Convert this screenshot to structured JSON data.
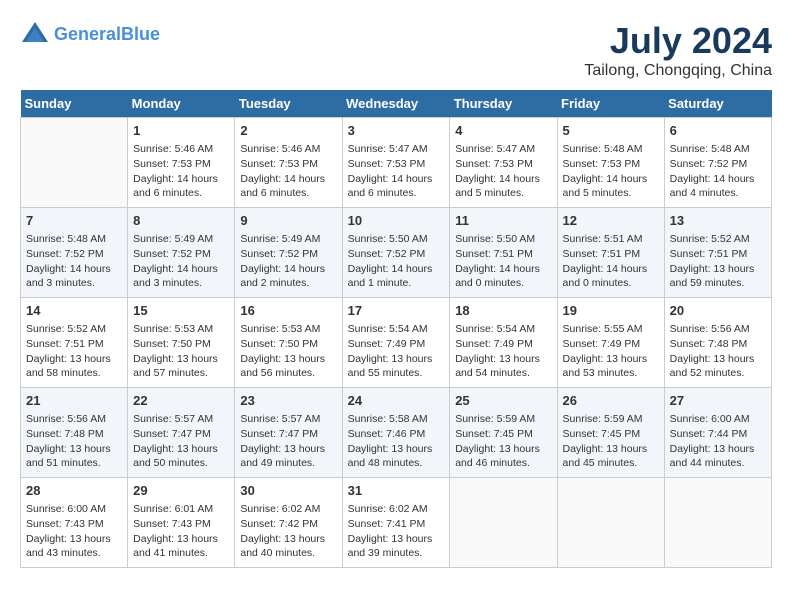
{
  "header": {
    "logo_line1": "General",
    "logo_line2": "Blue",
    "month_title": "July 2024",
    "location": "Tailong, Chongqing, China"
  },
  "days_of_week": [
    "Sunday",
    "Monday",
    "Tuesday",
    "Wednesday",
    "Thursday",
    "Friday",
    "Saturday"
  ],
  "weeks": [
    [
      {
        "day": "",
        "info": ""
      },
      {
        "day": "1",
        "info": "Sunrise: 5:46 AM\nSunset: 7:53 PM\nDaylight: 14 hours\nand 6 minutes."
      },
      {
        "day": "2",
        "info": "Sunrise: 5:46 AM\nSunset: 7:53 PM\nDaylight: 14 hours\nand 6 minutes."
      },
      {
        "day": "3",
        "info": "Sunrise: 5:47 AM\nSunset: 7:53 PM\nDaylight: 14 hours\nand 6 minutes."
      },
      {
        "day": "4",
        "info": "Sunrise: 5:47 AM\nSunset: 7:53 PM\nDaylight: 14 hours\nand 5 minutes."
      },
      {
        "day": "5",
        "info": "Sunrise: 5:48 AM\nSunset: 7:53 PM\nDaylight: 14 hours\nand 5 minutes."
      },
      {
        "day": "6",
        "info": "Sunrise: 5:48 AM\nSunset: 7:52 PM\nDaylight: 14 hours\nand 4 minutes."
      }
    ],
    [
      {
        "day": "7",
        "info": "Sunrise: 5:48 AM\nSunset: 7:52 PM\nDaylight: 14 hours\nand 3 minutes."
      },
      {
        "day": "8",
        "info": "Sunrise: 5:49 AM\nSunset: 7:52 PM\nDaylight: 14 hours\nand 3 minutes."
      },
      {
        "day": "9",
        "info": "Sunrise: 5:49 AM\nSunset: 7:52 PM\nDaylight: 14 hours\nand 2 minutes."
      },
      {
        "day": "10",
        "info": "Sunrise: 5:50 AM\nSunset: 7:52 PM\nDaylight: 14 hours\nand 1 minute."
      },
      {
        "day": "11",
        "info": "Sunrise: 5:50 AM\nSunset: 7:51 PM\nDaylight: 14 hours\nand 0 minutes."
      },
      {
        "day": "12",
        "info": "Sunrise: 5:51 AM\nSunset: 7:51 PM\nDaylight: 14 hours\nand 0 minutes."
      },
      {
        "day": "13",
        "info": "Sunrise: 5:52 AM\nSunset: 7:51 PM\nDaylight: 13 hours\nand 59 minutes."
      }
    ],
    [
      {
        "day": "14",
        "info": "Sunrise: 5:52 AM\nSunset: 7:51 PM\nDaylight: 13 hours\nand 58 minutes."
      },
      {
        "day": "15",
        "info": "Sunrise: 5:53 AM\nSunset: 7:50 PM\nDaylight: 13 hours\nand 57 minutes."
      },
      {
        "day": "16",
        "info": "Sunrise: 5:53 AM\nSunset: 7:50 PM\nDaylight: 13 hours\nand 56 minutes."
      },
      {
        "day": "17",
        "info": "Sunrise: 5:54 AM\nSunset: 7:49 PM\nDaylight: 13 hours\nand 55 minutes."
      },
      {
        "day": "18",
        "info": "Sunrise: 5:54 AM\nSunset: 7:49 PM\nDaylight: 13 hours\nand 54 minutes."
      },
      {
        "day": "19",
        "info": "Sunrise: 5:55 AM\nSunset: 7:49 PM\nDaylight: 13 hours\nand 53 minutes."
      },
      {
        "day": "20",
        "info": "Sunrise: 5:56 AM\nSunset: 7:48 PM\nDaylight: 13 hours\nand 52 minutes."
      }
    ],
    [
      {
        "day": "21",
        "info": "Sunrise: 5:56 AM\nSunset: 7:48 PM\nDaylight: 13 hours\nand 51 minutes."
      },
      {
        "day": "22",
        "info": "Sunrise: 5:57 AM\nSunset: 7:47 PM\nDaylight: 13 hours\nand 50 minutes."
      },
      {
        "day": "23",
        "info": "Sunrise: 5:57 AM\nSunset: 7:47 PM\nDaylight: 13 hours\nand 49 minutes."
      },
      {
        "day": "24",
        "info": "Sunrise: 5:58 AM\nSunset: 7:46 PM\nDaylight: 13 hours\nand 48 minutes."
      },
      {
        "day": "25",
        "info": "Sunrise: 5:59 AM\nSunset: 7:45 PM\nDaylight: 13 hours\nand 46 minutes."
      },
      {
        "day": "26",
        "info": "Sunrise: 5:59 AM\nSunset: 7:45 PM\nDaylight: 13 hours\nand 45 minutes."
      },
      {
        "day": "27",
        "info": "Sunrise: 6:00 AM\nSunset: 7:44 PM\nDaylight: 13 hours\nand 44 minutes."
      }
    ],
    [
      {
        "day": "28",
        "info": "Sunrise: 6:00 AM\nSunset: 7:43 PM\nDaylight: 13 hours\nand 43 minutes."
      },
      {
        "day": "29",
        "info": "Sunrise: 6:01 AM\nSunset: 7:43 PM\nDaylight: 13 hours\nand 41 minutes."
      },
      {
        "day": "30",
        "info": "Sunrise: 6:02 AM\nSunset: 7:42 PM\nDaylight: 13 hours\nand 40 minutes."
      },
      {
        "day": "31",
        "info": "Sunrise: 6:02 AM\nSunset: 7:41 PM\nDaylight: 13 hours\nand 39 minutes."
      },
      {
        "day": "",
        "info": ""
      },
      {
        "day": "",
        "info": ""
      },
      {
        "day": "",
        "info": ""
      }
    ]
  ]
}
